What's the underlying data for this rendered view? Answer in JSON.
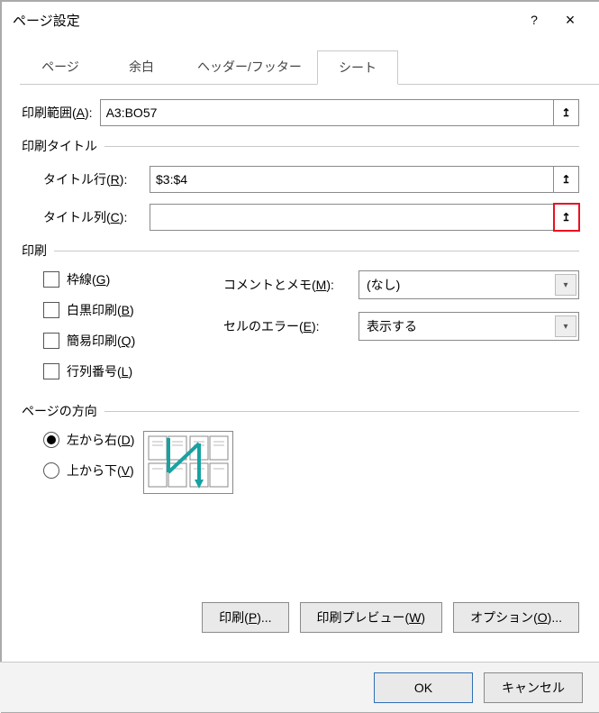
{
  "titlebar": {
    "title": "ページ設定",
    "help": "?",
    "close": "×"
  },
  "tabs": {
    "page": "ページ",
    "margins": "余白",
    "header_footer": "ヘッダー/フッター",
    "sheet": "シート"
  },
  "print_area": {
    "label_pre": "印刷範囲(",
    "label_key": "A",
    "label_post": "):",
    "value": "A3:BO57"
  },
  "print_titles": {
    "group": "印刷タイトル",
    "row_label_pre": "タイトル行(",
    "row_label_key": "R",
    "row_label_post": "):",
    "row_value": "$3:$4",
    "col_label_pre": "タイトル列(",
    "col_label_key": "C",
    "col_label_post": "):",
    "col_value": ""
  },
  "print_group": {
    "group": "印刷",
    "gridlines_pre": "枠線(",
    "gridlines_key": "G",
    "gridlines_post": ")",
    "bw_pre": "白黒印刷(",
    "bw_key": "B",
    "bw_post": ")",
    "draft_pre": "簡易印刷(",
    "draft_key": "Q",
    "draft_post": ")",
    "rowcol_pre": "行列番号(",
    "rowcol_key": "L",
    "rowcol_post": ")",
    "comments_pre": "コメントとメモ(",
    "comments_key": "M",
    "comments_post": "):",
    "comments_value": "(なし)",
    "errors_pre": "セルのエラー(",
    "errors_key": "E",
    "errors_post": "):",
    "errors_value": "表示する"
  },
  "page_order": {
    "group": "ページの方向",
    "ltr_pre": "左から右(",
    "ltr_key": "D",
    "ltr_post": ")",
    "ttb_pre": "上から下(",
    "ttb_key": "V",
    "ttb_post": ")"
  },
  "buttons": {
    "print_pre": "印刷(",
    "print_key": "P",
    "print_post": ")...",
    "preview_pre": "印刷プレビュー(",
    "preview_key": "W",
    "preview_post": ")",
    "options_pre": "オプション(",
    "options_key": "O",
    "options_post": ")...",
    "ok": "OK",
    "cancel": "キャンセル"
  }
}
